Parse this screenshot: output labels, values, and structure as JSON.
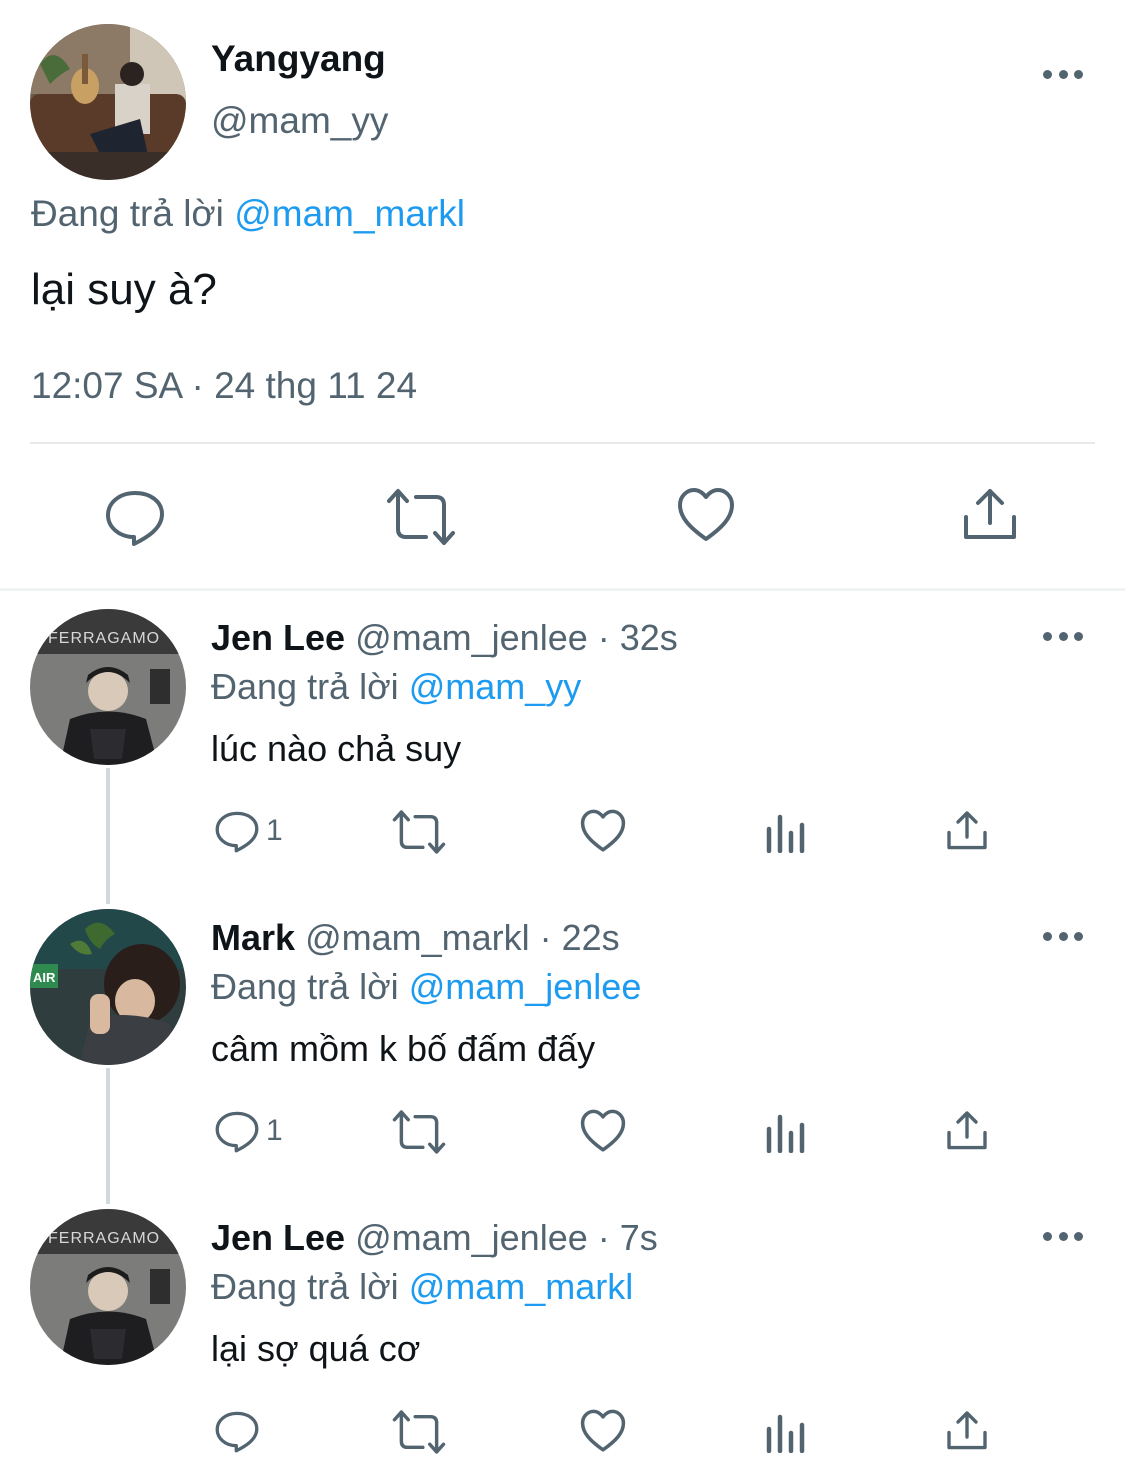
{
  "main_tweet": {
    "author_name": "Yangyang",
    "author_handle": "@mam_yy",
    "replying_prefix": "Đang trả lời",
    "replying_mention": "@mam_markl",
    "text": "lại suy à?",
    "timestamp": "12:07 SA · 24 thg 11 24"
  },
  "replies": [
    {
      "name": "Jen Lee",
      "meta": "@mam_jenlee · 32s",
      "replying_prefix": "Đang trả lời",
      "replying_mention": "@mam_yy",
      "text": "lúc nào chả suy",
      "reply_count": "1"
    },
    {
      "name": "Mark",
      "meta": "@mam_markl · 22s",
      "replying_prefix": "Đang trả lời",
      "replying_mention": "@mam_jenlee",
      "text": "câm mồm k bố đấm đấy",
      "reply_count": "1"
    },
    {
      "name": "Jen Lee",
      "meta": "@mam_jenlee · 7s",
      "replying_prefix": "Đang trả lời",
      "replying_mention": "@mam_markl",
      "text": "lại sợ quá cơ",
      "reply_count": ""
    }
  ],
  "colors": {
    "text_primary": "#0f1419",
    "text_secondary": "#536471",
    "link": "#1d9bf0",
    "divider": "#e7e9ea"
  }
}
